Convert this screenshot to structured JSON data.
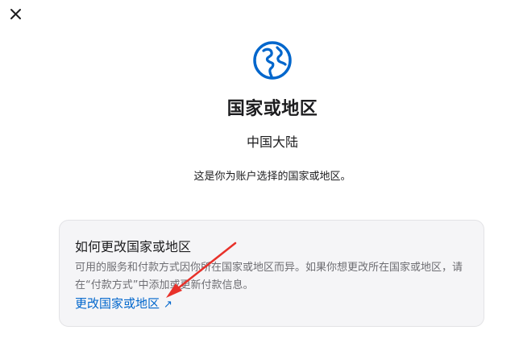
{
  "dialog": {
    "close_icon": "close-icon",
    "globe_icon": "globe-icon",
    "title": "国家或地区",
    "region": "中国大陆",
    "description": "这是你为账户选择的国家或地区。"
  },
  "card": {
    "title": "如何更改国家或地区",
    "body": "可用的服务和付款方式因你所在国家或地区而异。如果你想更改所在国家或地区，请在“付款方式”中添加或更新付款信息。",
    "link_label": "更改国家或地区",
    "link_icon": "external-arrow-icon"
  },
  "annotation": {
    "arrow_color": "#e8312a"
  },
  "colors": {
    "accent": "#0066cc",
    "card_background": "#f5f5f7",
    "text": "#1d1d1f",
    "secondary_text": "#6e6e73"
  }
}
